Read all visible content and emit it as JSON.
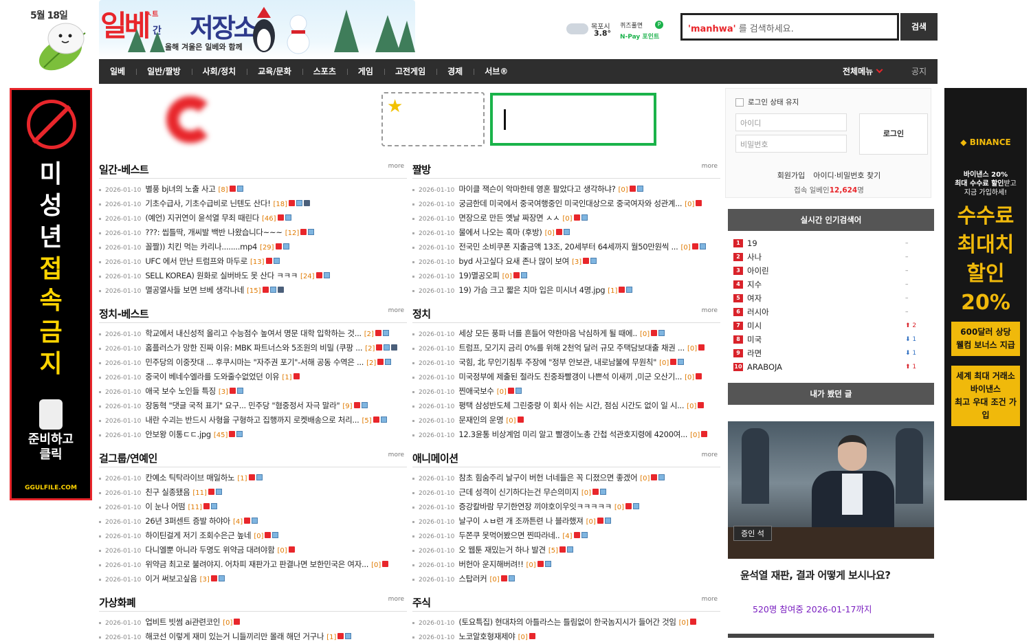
{
  "header": {
    "date_badge": "5월 18일",
    "site_logo": {
      "main1": "일베",
      "mini": "간",
      "main2": "저장소",
      "ilbe_subtext": "ㅅ트",
      "tagline": "올해 겨울은 일베와 함께"
    },
    "weather": {
      "city": "목포시",
      "temp": "3.8°",
      "icon": "cloud-icon"
    },
    "quiz": {
      "label": "퀴즈풀면",
      "reward": "N-Pay 포인트",
      "badge": "P"
    },
    "search": {
      "keyword": "'manhwa'",
      "suffix": "를 검색하세요.",
      "button": "검색"
    }
  },
  "nav": {
    "items": [
      "일베",
      "일반/짤방",
      "사회/정치",
      "교육/문화",
      "스포츠",
      "게임",
      "고전게임",
      "경제",
      "서브®"
    ],
    "all_menu": "전체메뉴",
    "notice": "공지"
  },
  "ads": {
    "left": {
      "lines": [
        "미",
        "성",
        "년"
      ],
      "yellow": [
        "접",
        "속",
        "금",
        "지"
      ],
      "cta1": "준비하고",
      "cta2": "클릭",
      "domain": "GGULFILE.COM"
    },
    "right": {
      "brand": "BINANCE",
      "line1": "바이낸스 20%",
      "line2": "최대 수수료 할인",
      "line2b": "받고",
      "line3": "지금 가입하세!",
      "big1": "수수료",
      "big2": "최대치",
      "big3": "할인",
      "big4": "20%",
      "box1a": "600달러 상당",
      "box1b": "웰컴 보너스 지급",
      "box2a": "세계 최대 거래소",
      "box2b": "바이낸스",
      "box2c": "최고 우대 조건 가입"
    }
  },
  "boards": [
    {
      "title": "일간-베스트",
      "more": "more",
      "posts": [
        {
          "date": "2026-01-10",
          "title": "별풍 bj녀의 노출 사고",
          "count": "[8]",
          "icons": [
            "n",
            "p"
          ]
        },
        {
          "date": "2026-01-10",
          "title": "기초수급사, 기초수급비로 닌텐도 산다!",
          "count": "[18]",
          "icons": [
            "n",
            "p",
            "v"
          ]
        },
        {
          "date": "2026-01-10",
          "title": "(예언) 지귀연이 윤석열 무죄 때린다",
          "count": "[46]",
          "icons": [
            "n",
            "p"
          ]
        },
        {
          "date": "2026-01-10",
          "title": "???: 씹틀딱, 개씨발 백반 나왔습니다~~~",
          "count": "[12]",
          "icons": [
            "n",
            "p"
          ]
        },
        {
          "date": "2026-01-10",
          "title": "꼴짤)) 치킨 먹는 카리나........mp4",
          "count": "[29]",
          "icons": [
            "n",
            "p"
          ]
        },
        {
          "date": "2026-01-10",
          "title": "UFC 에서 만난 트럼프와 마두로",
          "count": "[13]",
          "icons": [
            "n",
            "p"
          ]
        },
        {
          "date": "2026-01-10",
          "title": "SELL KOREA) 원화로 실버바도 못 산다 ㅋㅋㅋ",
          "count": "[24]",
          "icons": [
            "n",
            "p"
          ]
        },
        {
          "date": "2026-01-10",
          "title": "멸공열사들 보면 브베 생각나네",
          "count": "[15]",
          "icons": [
            "n",
            "p",
            "v"
          ]
        }
      ]
    },
    {
      "title": "짤방",
      "more": "more",
      "posts": [
        {
          "date": "2026-01-10",
          "title": "마이클 잭슨이 악마한테 영혼 팔았다고 생각하냐?",
          "count": "[0]",
          "icons": [
            "n",
            "p"
          ]
        },
        {
          "date": "2026-01-10",
          "title": "궁금한데 미국에서 중국여행중인 미국인대상으로 중국여자와 성관계...",
          "count": "[0]",
          "icons": [
            "n"
          ]
        },
        {
          "date": "2026-01-10",
          "title": "면장으로 만든 옛날 짜장면 ㅅㅅ",
          "count": "[0]",
          "icons": [
            "n",
            "p"
          ]
        },
        {
          "date": "2026-01-10",
          "title": "물에서 나오는 흑마 (후방)",
          "count": "[0]",
          "icons": [
            "n",
            "p"
          ]
        },
        {
          "date": "2026-01-10",
          "title": "전국민 소비쿠폰 지출금액 13조, 20세부터 64세까지 월50만원씩 ...",
          "count": "[0]",
          "icons": [
            "n",
            "p"
          ]
        },
        {
          "date": "2026-01-10",
          "title": "byd 사고싶다 요새 존나 많이 보여",
          "count": "[3]",
          "icons": [
            "n",
            "p"
          ]
        },
        {
          "date": "2026-01-10",
          "title": "19)멸공오피",
          "count": "[0]",
          "icons": [
            "n",
            "p"
          ]
        },
        {
          "date": "2026-01-10",
          "title": "19) 가슴 크고 짧은 치마 입은 미시녀 4명.jpg",
          "count": "[1]",
          "icons": [
            "n",
            "p"
          ]
        }
      ]
    },
    {
      "title": "정치-베스트",
      "more": "more",
      "posts": [
        {
          "date": "2026-01-10",
          "title": "학교에서 내신성적 올리고 수능점수 높여서 명문 대학 입학하는 것...",
          "count": "[2]",
          "icons": [
            "n",
            "p"
          ]
        },
        {
          "date": "2026-01-10",
          "title": "홈플러스가 망한 진짜 이유: MBK 파트너스와 5조원의 비밀 (쿠팡 ...",
          "count": "[2]",
          "icons": [
            "n",
            "p",
            "v"
          ]
        },
        {
          "date": "2026-01-10",
          "title": "민주당의 이중잣대 ... 후쿠시마는 \"자주권 포기\"-서해 공동 수역은 ...",
          "count": "[2]",
          "icons": [
            "n",
            "p"
          ]
        },
        {
          "date": "2026-01-10",
          "title": "중국이 베네수엘라를 도와줄수없었던 이유",
          "count": "[1]",
          "icons": [
            "n"
          ]
        },
        {
          "date": "2026-01-10",
          "title": "애국 보수 노인들 특징",
          "count": "[3]",
          "icons": [
            "n",
            "p"
          ]
        },
        {
          "date": "2026-01-10",
          "title": "장동혁 \"댓글 국적 표기\" 요구... 민주당 \"혐중정서 자극 말라\"",
          "count": "[9]",
          "icons": [
            "n",
            "p"
          ]
        },
        {
          "date": "2026-01-10",
          "title": "내란 수괴는 반드시 사형을 구형하고 집행까지 로켓배송으로 처리...",
          "count": "[5]",
          "icons": [
            "n",
            "p"
          ]
        },
        {
          "date": "2026-01-10",
          "title": "안보왕 이통ㄷㄷ.jpg",
          "count": "[45]",
          "icons": [
            "n",
            "p"
          ]
        }
      ]
    },
    {
      "title": "정치",
      "more": "more",
      "posts": [
        {
          "date": "2026-01-10",
          "title": "세상 모든 풍파 너를 흔들어 약한마음 낙심하게 될 때에..",
          "count": "[0]",
          "icons": [
            "n",
            "p"
          ]
        },
        {
          "date": "2026-01-10",
          "title": "트럼프, 모기지 금리 0%를 위해 2천억 달러 규모 주택담보대출 채권 ...",
          "count": "[0]",
          "icons": [
            "n"
          ]
        },
        {
          "date": "2026-01-10",
          "title": "국힘, 北 무인기침투 주장에 \"정부 안보관, 내로남불에 무원칙\"",
          "count": "[0]",
          "icons": [
            "n",
            "p"
          ]
        },
        {
          "date": "2026-01-10",
          "title": "미국정부에 제출된 절라도 친중좌빨갱이 나쁜석 이새끼 ,미군 오산기...",
          "count": "[0]",
          "icons": [
            "n"
          ]
        },
        {
          "date": "2026-01-10",
          "title": "찐애국보수",
          "count": "[0]",
          "icons": [
            "n",
            "p"
          ]
        },
        {
          "date": "2026-01-10",
          "title": "평택 삼성반도체 그린중량 이 회사 쉬는 시간, 점심 시간도 없이 일 시...",
          "count": "[0]",
          "icons": [
            "n"
          ]
        },
        {
          "date": "2026-01-10",
          "title": "문재인의 운명",
          "count": "[0]",
          "icons": [
            "n"
          ]
        },
        {
          "date": "2026-01-10",
          "title": "12.3윤통 비상계엄 미리 알고 빨갱이노총 간첩 석관호지령에 4200여...",
          "count": "[0]",
          "icons": [
            "n"
          ]
        }
      ]
    },
    {
      "title": "걸그룹/연예인",
      "more": "more",
      "posts": [
        {
          "date": "2026-01-10",
          "title": "칸예소 틱탁라이브 매일하노",
          "count": "[1]",
          "icons": [
            "n",
            "p"
          ]
        },
        {
          "date": "2026-01-10",
          "title": "친구 실종됐음",
          "count": "[11]",
          "icons": [
            "n",
            "p"
          ]
        },
        {
          "date": "2026-01-10",
          "title": "이 눈나 어떰",
          "count": "[11]",
          "icons": [
            "n",
            "p"
          ]
        },
        {
          "date": "2026-01-10",
          "title": "26년 3퍼센트 증발 하야아",
          "count": "[4]",
          "icons": [
            "n",
            "p"
          ]
        },
        {
          "date": "2026-01-10",
          "title": "하이틴걸게 저기 조회수은근 높네",
          "count": "[0]",
          "icons": [
            "n",
            "p"
          ]
        },
        {
          "date": "2026-01-10",
          "title": "다니엘뿐 아니라 두명도 위약금 대려야함",
          "count": "[0]",
          "icons": [
            "n"
          ]
        },
        {
          "date": "2026-01-10",
          "title": "위약금 최고로 불려야지. 어차피 재판가고 판결나면 보한민국은 여자...",
          "count": "[0]",
          "icons": [
            "n"
          ]
        },
        {
          "date": "2026-01-10",
          "title": "이거 써보고싶음",
          "count": "[3]",
          "icons": [
            "n",
            "p"
          ]
        }
      ]
    },
    {
      "title": "애니메이션",
      "more": "more",
      "posts": [
        {
          "date": "2026-01-10",
          "title": "참초 힘숨주리 날구이 버헌 너네들은 꼭 디졌으면 좋겠어",
          "count": "[0]",
          "icons": [
            "n",
            "p"
          ]
        },
        {
          "date": "2026-01-10",
          "title": "근데 성격이 신기하다는건 무슨의미지",
          "count": "[0]",
          "icons": [
            "n",
            "p"
          ]
        },
        {
          "date": "2026-01-10",
          "title": "증강칼바람 무기한연장 끼야호이우잇ㅋㅋㅋㅋㅋ",
          "count": "[0]",
          "icons": [
            "n",
            "p"
          ]
        },
        {
          "date": "2026-01-10",
          "title": "날구이 ㅅㅂ련 개 조까튼련 나 블라했져",
          "count": "[0]",
          "icons": [
            "n",
            "p"
          ]
        },
        {
          "date": "2026-01-10",
          "title": "두쫀쿠 못먹어봤으면 찐따라네..",
          "count": "[4]",
          "icons": [
            "n",
            "p"
          ]
        },
        {
          "date": "2026-01-10",
          "title": "오 웹툰 재밌는거 하나 발견",
          "count": "[5]",
          "icons": [
            "n",
            "p"
          ]
        },
        {
          "date": "2026-01-10",
          "title": "버헌아 운지해버려!!",
          "count": "[0]",
          "icons": [
            "n",
            "p"
          ]
        },
        {
          "date": "2026-01-10",
          "title": "스탑러커",
          "count": "[0]",
          "icons": [
            "n",
            "p"
          ]
        }
      ]
    },
    {
      "title": "가상화폐",
      "more": "more",
      "posts": [
        {
          "date": "2026-01-10",
          "title": "업비트 빗썸 ai관련코인",
          "count": "[0]",
          "icons": [
            "n"
          ]
        },
        {
          "date": "2026-01-10",
          "title": "해코선 이렇게 재미 있는거 니들끼리만 몰래 해던 거구나",
          "count": "[1]",
          "icons": [
            "n",
            "p"
          ]
        }
      ]
    },
    {
      "title": "주식",
      "more": "more",
      "posts": [
        {
          "date": "2026-01-10",
          "title": "(토요특집) 현대차의 아틀라스는 틀림없이 한국놈지시가 들어간 것임",
          "count": "[0]",
          "icons": [
            "n"
          ]
        },
        {
          "date": "2026-01-10",
          "title": "노코알호형재제야",
          "count": "[0]",
          "icons": [
            "n"
          ]
        }
      ]
    }
  ],
  "login": {
    "keep_label": "로그인 상태 유지",
    "id_placeholder": "아이디",
    "pw_placeholder": "비밀번호",
    "button": "로그인",
    "signup": "회원가입",
    "find": "아이디·비밀번호 찾기",
    "online_prefix": "접속 일베인",
    "online_count": "12,624",
    "online_suffix": "명"
  },
  "realtime": {
    "title": "실시간 인기검색어",
    "items": [
      {
        "rank": "1",
        "term": "19",
        "change": "–",
        "dir": "none"
      },
      {
        "rank": "2",
        "term": "사나",
        "change": "–",
        "dir": "none"
      },
      {
        "rank": "3",
        "term": "아이린",
        "change": "–",
        "dir": "none"
      },
      {
        "rank": "4",
        "term": "지수",
        "change": "–",
        "dir": "none"
      },
      {
        "rank": "5",
        "term": "여자",
        "change": "–",
        "dir": "none"
      },
      {
        "rank": "6",
        "term": "러시아",
        "change": "–",
        "dir": "none"
      },
      {
        "rank": "7",
        "term": "미시",
        "change": "2",
        "dir": "up"
      },
      {
        "rank": "8",
        "term": "미국",
        "change": "1",
        "dir": "down"
      },
      {
        "rank": "9",
        "term": "라면",
        "change": "1",
        "dir": "down"
      },
      {
        "rank": "10",
        "term": "ARABOJA",
        "change": "1",
        "dir": "up"
      }
    ]
  },
  "viewed": {
    "title": "내가 봤던 글"
  },
  "poll": {
    "plate": "증인 석",
    "question": "윤석열 재판, 결과 어떻게 보시나요?",
    "info": "520명 참여중 2026-01-17까지"
  }
}
